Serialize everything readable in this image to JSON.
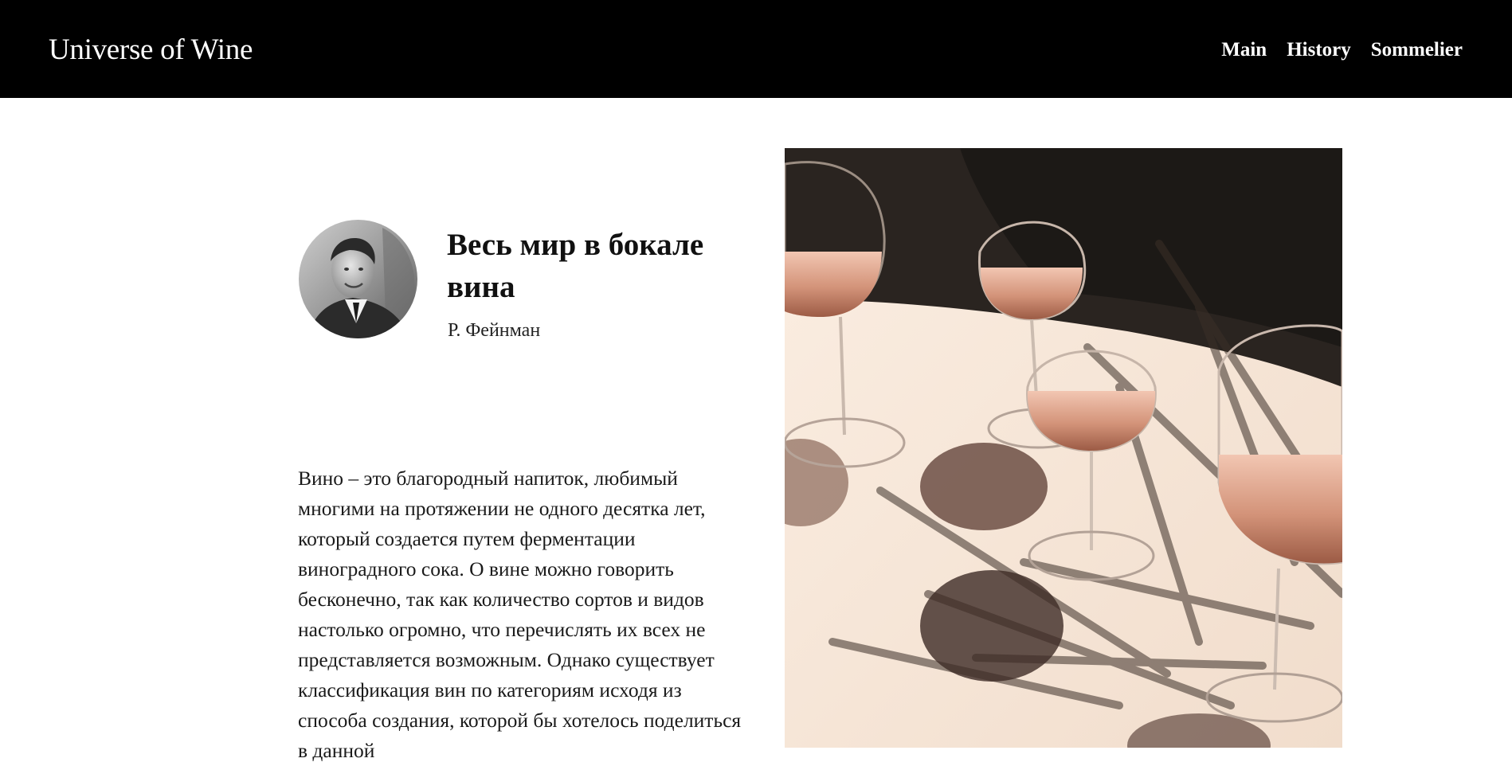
{
  "header": {
    "brand": "Universe of Wine",
    "nav": [
      "Main",
      "History",
      "Sommelier"
    ]
  },
  "quote": {
    "title": "Весь мир в бокале вина",
    "author": "Р. Фейнман"
  },
  "article": {
    "text": "Вино – это благородный напиток, любимый многими на протяжении не одного десятка лет, который создается путем ферментации виноградного сока. О вине можно говорить бесконечно, так как количество сортов и видов настолько огромно, что перечислять их всех не представляется возможным. Однако существует классификация вин по категориям исходя из способа создания, которой бы хотелось поделиться в данной"
  },
  "colors": {
    "header_bg": "#000000",
    "header_text": "#ffffff",
    "page_bg": "#ffffff",
    "text": "#1a1a1a",
    "wine": "#d99a82"
  },
  "images": {
    "avatar": "portrait-photo",
    "hero": "wine-glasses-photo"
  }
}
